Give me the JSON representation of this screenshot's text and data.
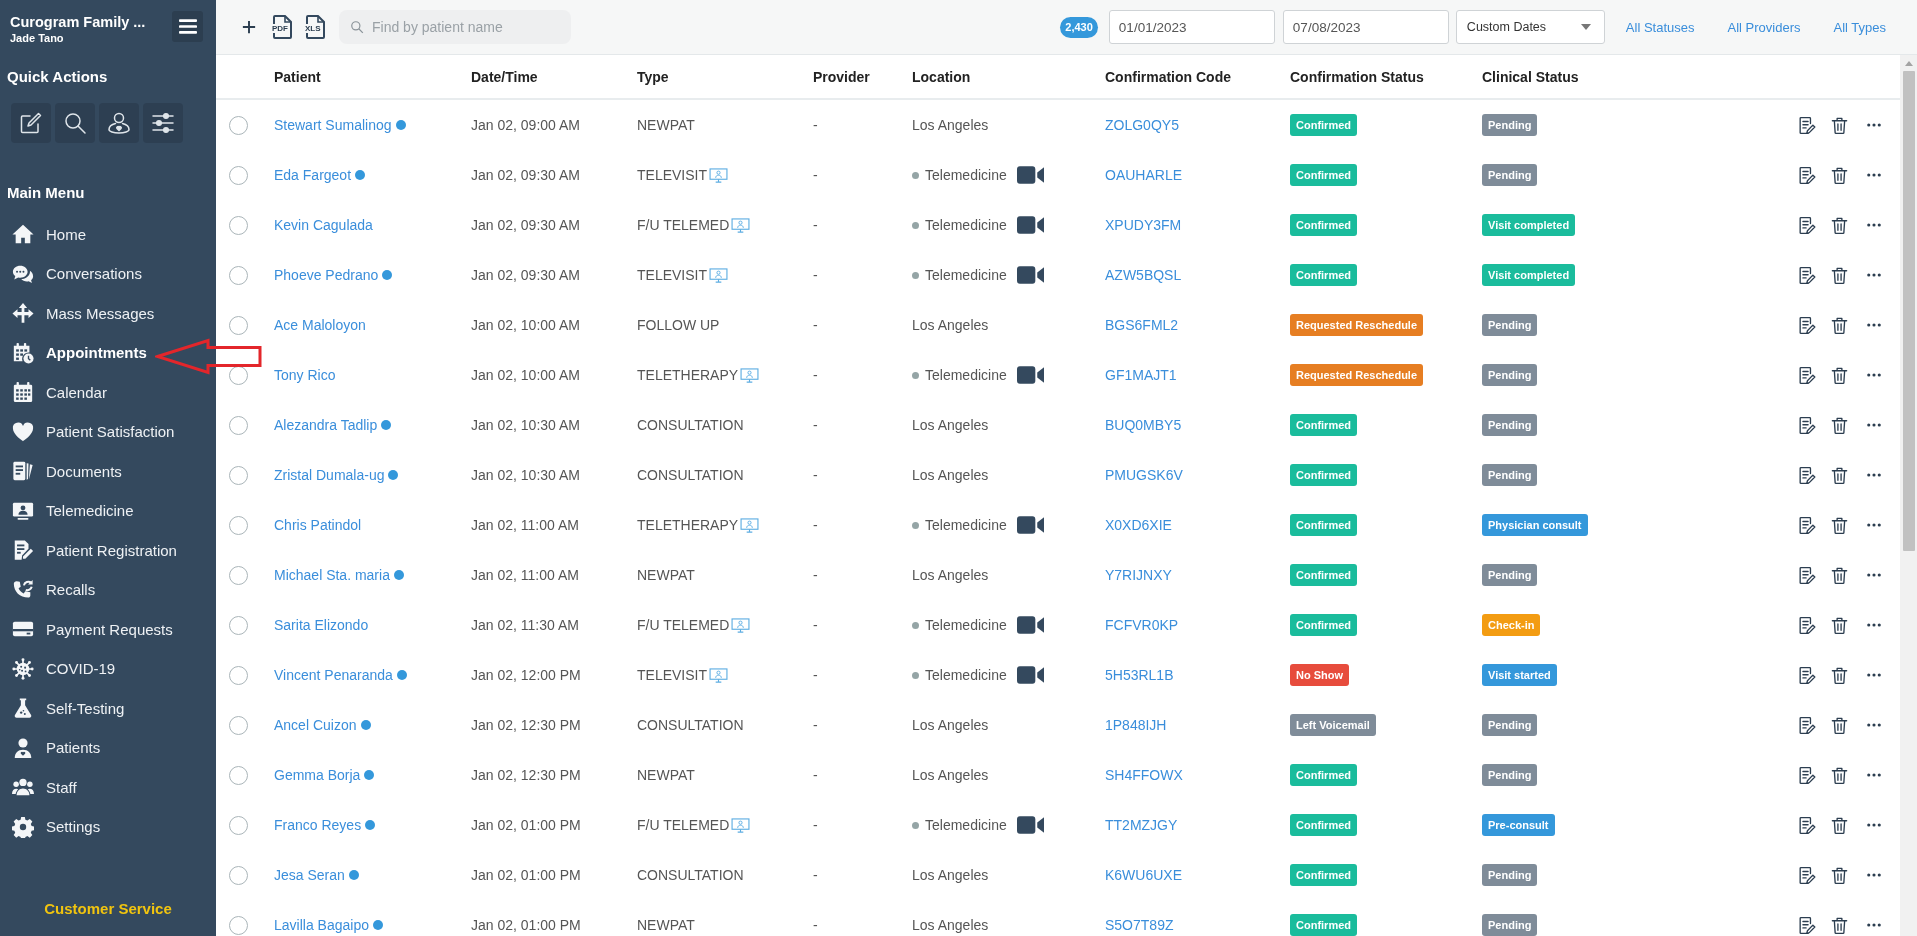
{
  "sidebar": {
    "practice_name": "Curogram Family ...",
    "user_name": "Jade Tano",
    "quick_actions_heading": "Quick Actions",
    "main_menu_heading": "Main Menu",
    "items": [
      {
        "label": "Home",
        "selected": false
      },
      {
        "label": "Conversations",
        "selected": false
      },
      {
        "label": "Mass Messages",
        "selected": false
      },
      {
        "label": "Appointments",
        "selected": true
      },
      {
        "label": "Calendar",
        "selected": false
      },
      {
        "label": "Patient Satisfaction",
        "selected": false
      },
      {
        "label": "Documents",
        "selected": false
      },
      {
        "label": "Telemedicine",
        "selected": false
      },
      {
        "label": "Patient Registration",
        "selected": false
      },
      {
        "label": "Recalls",
        "selected": false
      },
      {
        "label": "Payment Requests",
        "selected": false
      },
      {
        "label": "COVID-19",
        "selected": false
      },
      {
        "label": "Self-Testing",
        "selected": false
      },
      {
        "label": "Patients",
        "selected": false
      },
      {
        "label": "Staff",
        "selected": false
      },
      {
        "label": "Settings",
        "selected": false
      }
    ],
    "footer_link": "Customer Service"
  },
  "toolbar": {
    "export_labels": [
      "PDF",
      "XLS"
    ],
    "search": {
      "placeholder": "Find by patient name"
    },
    "count_badge": "2,430",
    "start_date": "01/01/2023",
    "end_date": "07/08/2023",
    "range_dropdown": "Custom Dates",
    "filters": [
      "All Statuses",
      "All Providers",
      "All Types"
    ]
  },
  "table": {
    "columns": [
      "Patient",
      "Date/Time",
      "Type",
      "Provider",
      "Location",
      "Confirmation Code",
      "Confirmation Status",
      "Clinical Status"
    ],
    "rows": [
      {
        "selected": false,
        "patient": "Stewart Sumalinog",
        "indicator_dot": true,
        "date_time": "Jan 02, 09:00 AM",
        "type": "NEWPAT",
        "type_icon": false,
        "provider": "-",
        "location": {
          "kind": "office",
          "name": "Los Angeles"
        },
        "confirmation_code": "ZOLG0QY5",
        "confirmation_status": {
          "label": "Confirmed",
          "color": "#1abc9c"
        },
        "clinical_status": {
          "label": "Pending",
          "color": "#7f8c99"
        }
      },
      {
        "selected": false,
        "patient": "Eda Fargeot",
        "indicator_dot": true,
        "date_time": "Jan 02, 09:30 AM",
        "type": "TELEVISIT",
        "type_icon": true,
        "provider": "-",
        "location": {
          "kind": "telemedicine",
          "name": "Telemedicine"
        },
        "confirmation_code": "OAUHARLE",
        "confirmation_status": {
          "label": "Confirmed",
          "color": "#1abc9c"
        },
        "clinical_status": {
          "label": "Pending",
          "color": "#7f8c99"
        }
      },
      {
        "selected": false,
        "patient": "Kevin Cagulada",
        "indicator_dot": false,
        "date_time": "Jan 02, 09:30 AM",
        "type": "F/U TELEMED",
        "type_icon": true,
        "provider": "-",
        "location": {
          "kind": "telemedicine",
          "name": "Telemedicine"
        },
        "confirmation_code": "XPUDY3FM",
        "confirmation_status": {
          "label": "Confirmed",
          "color": "#1abc9c"
        },
        "clinical_status": {
          "label": "Visit completed",
          "color": "#1abc9c"
        }
      },
      {
        "selected": false,
        "patient": "Phoeve Pedrano",
        "indicator_dot": true,
        "date_time": "Jan 02, 09:30 AM",
        "type": "TELEVISIT",
        "type_icon": true,
        "provider": "-",
        "location": {
          "kind": "telemedicine",
          "name": "Telemedicine"
        },
        "confirmation_code": "AZW5BQSL",
        "confirmation_status": {
          "label": "Confirmed",
          "color": "#1abc9c"
        },
        "clinical_status": {
          "label": "Visit completed",
          "color": "#1abc9c"
        }
      },
      {
        "selected": false,
        "patient": "Ace Maloloyon",
        "indicator_dot": false,
        "date_time": "Jan 02, 10:00 AM",
        "type": "FOLLOW UP",
        "type_icon": false,
        "provider": "-",
        "location": {
          "kind": "office",
          "name": "Los Angeles"
        },
        "confirmation_code": "BGS6FML2",
        "confirmation_status": {
          "label": "Requested Reschedule",
          "color": "#e67e22"
        },
        "clinical_status": {
          "label": "Pending",
          "color": "#7f8c99"
        }
      },
      {
        "selected": false,
        "patient": "Tony Rico",
        "indicator_dot": false,
        "date_time": "Jan 02, 10:00 AM",
        "type": "TELETHERAPY",
        "type_icon": true,
        "provider": "-",
        "location": {
          "kind": "telemedicine",
          "name": "Telemedicine"
        },
        "confirmation_code": "GF1MAJT1",
        "confirmation_status": {
          "label": "Requested Reschedule",
          "color": "#e67e22"
        },
        "clinical_status": {
          "label": "Pending",
          "color": "#7f8c99"
        }
      },
      {
        "selected": false,
        "patient": "Alezandra Tadlip",
        "indicator_dot": true,
        "date_time": "Jan 02, 10:30 AM",
        "type": "CONSULTATION",
        "type_icon": false,
        "provider": "-",
        "location": {
          "kind": "office",
          "name": "Los Angeles"
        },
        "confirmation_code": "BUQ0MBY5",
        "confirmation_status": {
          "label": "Confirmed",
          "color": "#1abc9c"
        },
        "clinical_status": {
          "label": "Pending",
          "color": "#7f8c99"
        }
      },
      {
        "selected": false,
        "patient": "Zristal Dumala-ug",
        "indicator_dot": true,
        "date_time": "Jan 02, 10:30 AM",
        "type": "CONSULTATION",
        "type_icon": false,
        "provider": "-",
        "location": {
          "kind": "office",
          "name": "Los Angeles"
        },
        "confirmation_code": "PMUGSK6V",
        "confirmation_status": {
          "label": "Confirmed",
          "color": "#1abc9c"
        },
        "clinical_status": {
          "label": "Pending",
          "color": "#7f8c99"
        }
      },
      {
        "selected": false,
        "patient": "Chris Patindol",
        "indicator_dot": false,
        "date_time": "Jan 02, 11:00 AM",
        "type": "TELETHERAPY",
        "type_icon": true,
        "provider": "-",
        "location": {
          "kind": "telemedicine",
          "name": "Telemedicine"
        },
        "confirmation_code": "X0XD6XIE",
        "confirmation_status": {
          "label": "Confirmed",
          "color": "#1abc9c"
        },
        "clinical_status": {
          "label": "Physician consult",
          "color": "#3498db"
        }
      },
      {
        "selected": false,
        "patient": "Michael Sta. maria",
        "indicator_dot": true,
        "date_time": "Jan 02, 11:00 AM",
        "type": "NEWPAT",
        "type_icon": false,
        "provider": "-",
        "location": {
          "kind": "office",
          "name": "Los Angeles"
        },
        "confirmation_code": "Y7RIJNXY",
        "confirmation_status": {
          "label": "Confirmed",
          "color": "#1abc9c"
        },
        "clinical_status": {
          "label": "Pending",
          "color": "#7f8c99"
        }
      },
      {
        "selected": false,
        "patient": "Sarita Elizondo",
        "indicator_dot": false,
        "date_time": "Jan 02, 11:30 AM",
        "type": "F/U TELEMED",
        "type_icon": true,
        "provider": "-",
        "location": {
          "kind": "telemedicine",
          "name": "Telemedicine"
        },
        "confirmation_code": "FCFVR0KP",
        "confirmation_status": {
          "label": "Confirmed",
          "color": "#1abc9c"
        },
        "clinical_status": {
          "label": "Check-in",
          "color": "#f39c12"
        }
      },
      {
        "selected": false,
        "patient": "Vincent Penaranda",
        "indicator_dot": true,
        "date_time": "Jan 02, 12:00 PM",
        "type": "TELEVISIT",
        "type_icon": true,
        "provider": "-",
        "location": {
          "kind": "telemedicine",
          "name": "Telemedicine"
        },
        "confirmation_code": "5H53RL1B",
        "confirmation_status": {
          "label": "No Show",
          "color": "#e74c3c"
        },
        "clinical_status": {
          "label": "Visit started",
          "color": "#3498db"
        }
      },
      {
        "selected": false,
        "patient": "Ancel Cuizon",
        "indicator_dot": true,
        "date_time": "Jan 02, 12:30 PM",
        "type": "CONSULTATION",
        "type_icon": false,
        "provider": "-",
        "location": {
          "kind": "office",
          "name": "Los Angeles"
        },
        "confirmation_code": "1P848IJH",
        "confirmation_status": {
          "label": "Left Voicemail",
          "color": "#7f8c99"
        },
        "clinical_status": {
          "label": "Pending",
          "color": "#7f8c99"
        }
      },
      {
        "selected": false,
        "patient": "Gemma Borja",
        "indicator_dot": true,
        "date_time": "Jan 02, 12:30 PM",
        "type": "NEWPAT",
        "type_icon": false,
        "provider": "-",
        "location": {
          "kind": "office",
          "name": "Los Angeles"
        },
        "confirmation_code": "SH4FFOWX",
        "confirmation_status": {
          "label": "Confirmed",
          "color": "#1abc9c"
        },
        "clinical_status": {
          "label": "Pending",
          "color": "#7f8c99"
        }
      },
      {
        "selected": false,
        "patient": "Franco Reyes",
        "indicator_dot": true,
        "date_time": "Jan 02, 01:00 PM",
        "type": "F/U TELEMED",
        "type_icon": true,
        "provider": "-",
        "location": {
          "kind": "telemedicine",
          "name": "Telemedicine"
        },
        "confirmation_code": "TT2MZJGY",
        "confirmation_status": {
          "label": "Confirmed",
          "color": "#1abc9c"
        },
        "clinical_status": {
          "label": "Pre-consult",
          "color": "#3498db"
        }
      },
      {
        "selected": false,
        "patient": "Jesa Seran",
        "indicator_dot": true,
        "date_time": "Jan 02, 01:00 PM",
        "type": "CONSULTATION",
        "type_icon": false,
        "provider": "-",
        "location": {
          "kind": "office",
          "name": "Los Angeles"
        },
        "confirmation_code": "K6WU6UXE",
        "confirmation_status": {
          "label": "Confirmed",
          "color": "#1abc9c"
        },
        "clinical_status": {
          "label": "Pending",
          "color": "#7f8c99"
        }
      },
      {
        "selected": false,
        "patient": "Lavilla Bagaipo",
        "indicator_dot": true,
        "date_time": "Jan 02, 01:00 PM",
        "type": "NEWPAT",
        "type_icon": false,
        "provider": "-",
        "location": {
          "kind": "office",
          "name": "Los Angeles"
        },
        "confirmation_code": "S5O7T89Z",
        "confirmation_status": {
          "label": "Confirmed",
          "color": "#1abc9c"
        },
        "clinical_status": {
          "label": "Pending",
          "color": "#7f8c99"
        }
      }
    ]
  }
}
